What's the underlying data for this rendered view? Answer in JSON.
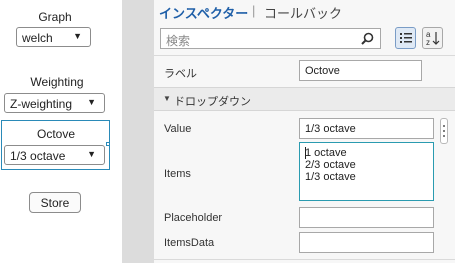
{
  "canvas": {
    "graph_label": "Graph",
    "graph_value": "welch",
    "weighting_label": "Weighting",
    "weighting_value": "Z-weighting",
    "octave_label": "Octove",
    "octave_value": "1/3 octave",
    "store_button": "Store"
  },
  "inspector": {
    "tab_inspector": "インスペクター",
    "tab_separator": "|",
    "tab_callback": "コールバック",
    "search_placeholder": "検索",
    "label_name": "ラベル",
    "label_value": "Octove",
    "section_title": "ドロップダウン",
    "value_name": "Value",
    "value_value": "1/3 octave",
    "items_name": "Items",
    "items": [
      "1 octave",
      "2/3 octave",
      "1/3 octave"
    ],
    "placeholder_name": "Placeholder",
    "placeholder_value": "",
    "itemsdata_name": "ItemsData",
    "itemsdata_value": ""
  }
}
